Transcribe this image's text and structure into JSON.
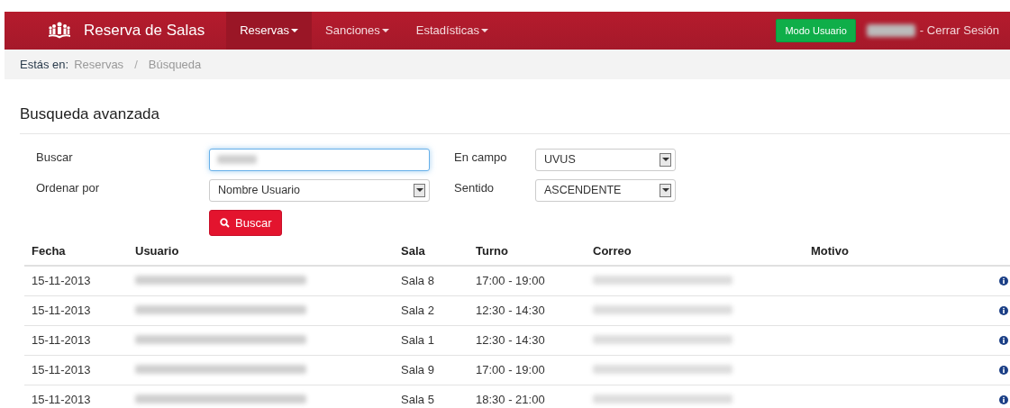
{
  "navbar": {
    "brand": "Reserva de Salas",
    "menus": [
      {
        "label": "Reservas",
        "selected": true
      },
      {
        "label": "Sanciones",
        "selected": false
      },
      {
        "label": "Estadísticas",
        "selected": false
      }
    ],
    "mode_button": "Modo Usuario",
    "logout": "- Cerrar Sesión"
  },
  "breadcrumb": {
    "prefix": "Estás en:",
    "items": [
      "Reservas",
      "Búsqueda"
    ],
    "separator": "/"
  },
  "heading": "Busqueda avanzada",
  "form": {
    "search_label": "Buscar",
    "order_label": "Ordenar por",
    "order_value": "Nombre Usuario",
    "field_label": "En campo",
    "field_value": "UVUS",
    "direction_label": "Sentido",
    "direction_value": "ASCENDENTE",
    "search_button": "Buscar"
  },
  "table": {
    "columns": [
      "Fecha",
      "Usuario",
      "Sala",
      "Turno",
      "Correo",
      "Motivo"
    ],
    "rows": [
      {
        "fecha": "15-11-2013",
        "sala": "Sala 8",
        "turno": "17:00 - 19:00"
      },
      {
        "fecha": "15-11-2013",
        "sala": "Sala 2",
        "turno": "12:30 - 14:30"
      },
      {
        "fecha": "15-11-2013",
        "sala": "Sala 1",
        "turno": "12:30 - 14:30"
      },
      {
        "fecha": "15-11-2013",
        "sala": "Sala 9",
        "turno": "17:00 - 19:00"
      },
      {
        "fecha": "15-11-2013",
        "sala": "Sala 5",
        "turno": "18:30 - 21:00"
      }
    ]
  }
}
